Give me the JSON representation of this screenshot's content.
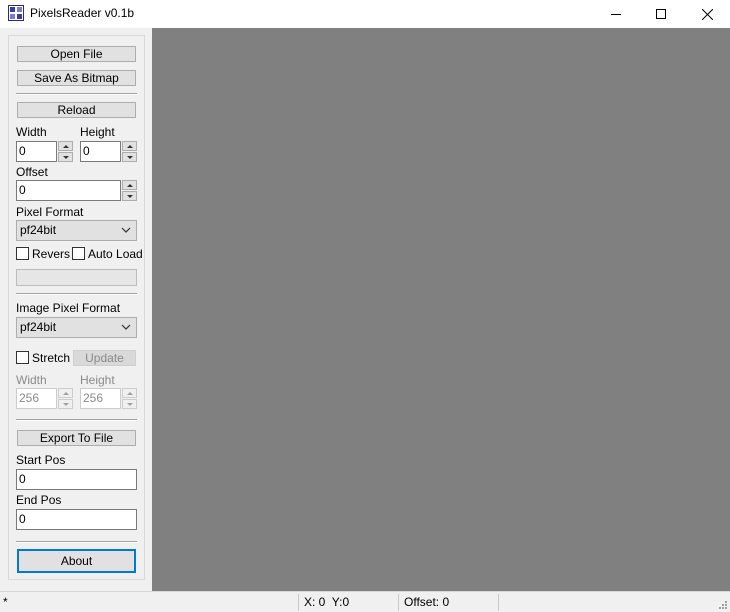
{
  "window": {
    "title": "PixelsReader v0.1b",
    "icon": "app-grid-icon",
    "controls": [
      "minimize-icon",
      "maximize-icon",
      "close-icon"
    ]
  },
  "panel": {
    "open_file": "Open File",
    "save_as_bitmap": "Save As Bitmap",
    "reload": "Reload",
    "width_label": "Width",
    "height_label": "Height",
    "width_value": "0",
    "height_value": "0",
    "offset_label": "Offset",
    "offset_value": "0",
    "pixel_format_label": "Pixel Format",
    "pixel_format_value": "pf24bit",
    "revers_label": "Revers",
    "auto_load_label": "Auto Load",
    "image_pixel_format_label": "Image Pixel Format",
    "image_pixel_format_value": "pf24bit",
    "stretch_label": "Stretch",
    "update": "Update",
    "img_width_label": "Width",
    "img_height_label": "Height",
    "img_width_value": "256",
    "img_height_value": "256",
    "export_to_file": "Export To File",
    "start_pos_label": "Start Pos",
    "start_pos_value": "0",
    "end_pos_label": "End Pos",
    "end_pos_value": "0",
    "about": "About"
  },
  "statusbar": {
    "left": "*",
    "coords": "X: 0  Y:0",
    "offset": "Offset: 0"
  },
  "colors": {
    "canvas": "#808080",
    "accent": "#0078d7"
  }
}
